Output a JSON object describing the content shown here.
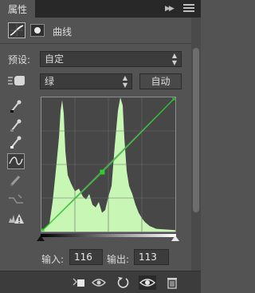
{
  "panel": {
    "tab_label": "属性",
    "title": "曲线"
  },
  "preset": {
    "label": "预设:",
    "value": "自定"
  },
  "channel": {
    "value": "绿",
    "auto_label": "自动"
  },
  "curve": {
    "accent": "#2bd02b",
    "histogram_color": "#c8f6b4",
    "points": [
      [
        0,
        0
      ],
      [
        116,
        113
      ],
      [
        255,
        255
      ]
    ]
  },
  "io": {
    "input_label": "输入:",
    "input_value": "116",
    "output_label": "输出:",
    "output_value": "113"
  },
  "icons": {
    "tools": [
      "eyedropper-icon",
      "eyedropper-gray-icon",
      "eyedropper-white-icon",
      "curve-edit-icon",
      "pencil-icon",
      "smooth-icon",
      "clipping-warning-icon"
    ],
    "bottom": [
      "clip-to-layer-icon",
      "view-previous-icon",
      "reset-icon",
      "visibility-icon",
      "trash-icon"
    ]
  }
}
